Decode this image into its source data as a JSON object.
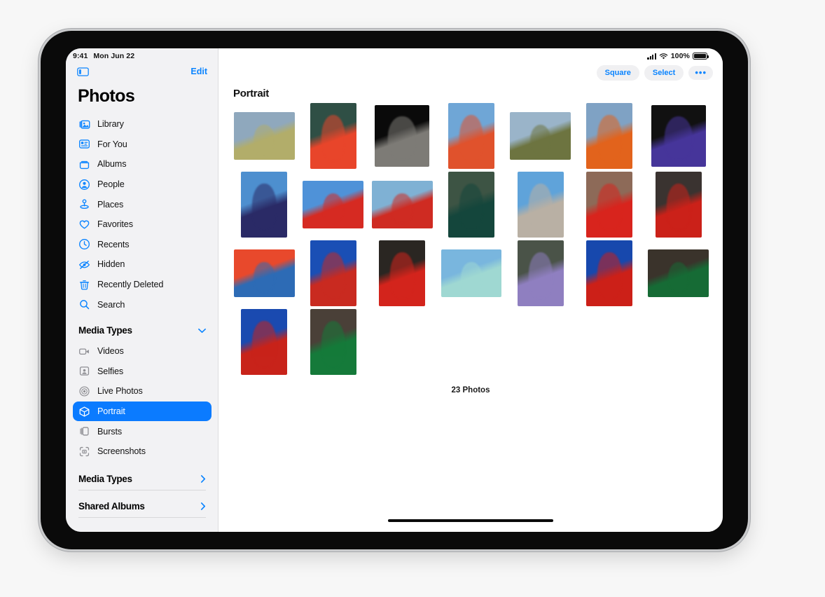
{
  "status_bar": {
    "time": "9:41",
    "date": "Mon Jun 22",
    "battery_percent": "100%",
    "cellular_icon": "signal-bars-icon",
    "wifi_icon": "wifi-icon",
    "battery_icon": "battery-icon"
  },
  "sidebar": {
    "toggle_icon": "sidebar-toggle-icon",
    "edit_label": "Edit",
    "title": "Photos",
    "items": [
      {
        "label": "Library",
        "icon": "library-icon"
      },
      {
        "label": "For You",
        "icon": "for-you-icon"
      },
      {
        "label": "Albums",
        "icon": "albums-icon"
      },
      {
        "label": "People",
        "icon": "people-icon"
      },
      {
        "label": "Places",
        "icon": "places-icon"
      },
      {
        "label": "Favorites",
        "icon": "heart-icon"
      },
      {
        "label": "Recents",
        "icon": "clock-icon"
      },
      {
        "label": "Hidden",
        "icon": "eye-slash-icon"
      },
      {
        "label": "Recently Deleted",
        "icon": "trash-icon"
      },
      {
        "label": "Search",
        "icon": "search-icon"
      }
    ],
    "media_types_section": {
      "header": "Media Types",
      "chevron": "chevron-down-icon",
      "items": [
        {
          "label": "Videos",
          "icon": "video-icon",
          "selected": false
        },
        {
          "label": "Selfies",
          "icon": "selfie-icon",
          "selected": false
        },
        {
          "label": "Live Photos",
          "icon": "live-photo-icon",
          "selected": false
        },
        {
          "label": "Portrait",
          "icon": "portrait-cube-icon",
          "selected": true
        },
        {
          "label": "Bursts",
          "icon": "bursts-icon",
          "selected": false
        },
        {
          "label": "Screenshots",
          "icon": "screenshot-icon",
          "selected": false
        }
      ]
    },
    "footer_sections": [
      {
        "label": "Media Types",
        "chevron": "chevron-right-icon"
      },
      {
        "label": "Shared Albums",
        "chevron": "chevron-right-icon"
      }
    ]
  },
  "toolbar": {
    "square_label": "Square",
    "select_label": "Select",
    "more_label": "•••",
    "more_icon": "ellipsis-icon"
  },
  "content": {
    "title": "Portrait",
    "photo_count": "23 Photos",
    "accent_color": "#0a84ff",
    "selected_color": "#0b7bff",
    "photos": [
      {
        "shape": "land",
        "alt": "man in blue shirt yellow tee by river",
        "c1": "#8fa8bd",
        "c2": "#b2ad6a"
      },
      {
        "shape": "port",
        "alt": "person green beanie red hoodie",
        "c1": "#2f4f45",
        "c2": "#e8452a"
      },
      {
        "shape": "sq",
        "alt": "black and white portrait man",
        "c1": "#0a0a0a",
        "c2": "#7d7b76"
      },
      {
        "shape": "port",
        "alt": "person orange jacket blue sky",
        "c1": "#6fa6d6",
        "c2": "#e0522c"
      },
      {
        "shape": "land",
        "alt": "man holding sneakers waterfront",
        "c1": "#9ab4c9",
        "c2": "#6d7440"
      },
      {
        "shape": "port",
        "alt": "person orange top trees background",
        "c1": "#7fa2c4",
        "c2": "#e2631c"
      },
      {
        "shape": "sq",
        "alt": "person purple beanie dark background",
        "c1": "#111111",
        "c2": "#46359a"
      },
      {
        "shape": "port",
        "alt": "person navy beanie pink shirt",
        "c1": "#4d8fcf",
        "c2": "#2a2a66"
      },
      {
        "shape": "land",
        "alt": "person red coat low angle sky",
        "c1": "#4f92d8",
        "c2": "#d62a22"
      },
      {
        "shape": "land",
        "alt": "person red jacket green field",
        "c1": "#7fb1d4",
        "c2": "#cf2b22"
      },
      {
        "shape": "port",
        "alt": "person black beanie green top",
        "c1": "#3d5444",
        "c2": "#14463c"
      },
      {
        "shape": "port",
        "alt": "smiling man grey hair blue sky",
        "c1": "#5fa3da",
        "c2": "#b9b0a4"
      },
      {
        "shape": "port",
        "alt": "person red cape patterned dress",
        "c1": "#8d6a58",
        "c2": "#d8241d"
      },
      {
        "shape": "port",
        "alt": "person white sunglasses red shirt",
        "c1": "#3a3330",
        "c2": "#cb2119"
      },
      {
        "shape": "land",
        "alt": "man black cap blue shirt red wall",
        "c1": "#e8492c",
        "c2": "#2d6bb5"
      },
      {
        "shape": "port",
        "alt": "person red hoodie blue sky low angle",
        "c1": "#1a4fb5",
        "c2": "#c92a20"
      },
      {
        "shape": "port",
        "alt": "person red shirt dark interior",
        "c1": "#2a2622",
        "c2": "#d3241c"
      },
      {
        "shape": "land",
        "alt": "person mint bucket hat city",
        "c1": "#79b6de",
        "c2": "#9fd8d2"
      },
      {
        "shape": "port",
        "alt": "person floral shirt by wall",
        "c1": "#4a5348",
        "c2": "#8f7fc0"
      },
      {
        "shape": "port",
        "alt": "person red dress against blue sky",
        "c1": "#1748ad",
        "c2": "#cc2018"
      },
      {
        "shape": "land",
        "alt": "person green dress dark wall",
        "c1": "#3a332b",
        "c2": "#166b35"
      },
      {
        "shape": "port",
        "alt": "person red dress blue sky vertical",
        "c1": "#1a4ab0",
        "c2": "#c8231a"
      },
      {
        "shape": "port",
        "alt": "person green dress warm wall",
        "c1": "#4a4038",
        "c2": "#157a3a"
      }
    ]
  }
}
